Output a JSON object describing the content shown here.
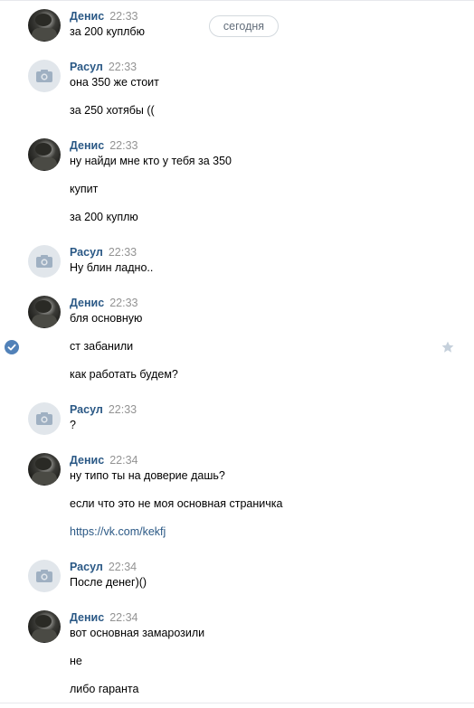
{
  "date_separator": "сегодня",
  "messages": [
    {
      "author": "Денис",
      "time": "22:33",
      "avatar": "photo",
      "lines": [
        "за 200 куплбю"
      ]
    },
    {
      "author": "Расул",
      "time": "22:33",
      "avatar": "camera-icon",
      "lines": [
        "она 350 же стоит",
        "за 250 хотябы (("
      ]
    },
    {
      "author": "Денис",
      "time": "22:33",
      "avatar": "photo",
      "lines": [
        "ну найди мне кто у тебя за 350",
        "купит",
        "за 200 куплю"
      ]
    },
    {
      "author": "Расул",
      "time": "22:33",
      "avatar": "camera-icon",
      "lines": [
        "Ну блин ладно.."
      ]
    },
    {
      "author": "Денис",
      "time": "22:33",
      "avatar": "photo",
      "lines": [
        "бля основную",
        "ст забанили",
        "как работать будем?"
      ]
    },
    {
      "author": "Расул",
      "time": "22:33",
      "avatar": "camera-icon",
      "lines": [
        "?"
      ]
    },
    {
      "author": "Денис",
      "time": "22:34",
      "avatar": "photo",
      "lines": [
        "ну типо ты на доверие дашь?",
        "если что это не моя основная страничка",
        "https://vk.com/kekfj"
      ]
    },
    {
      "author": "Расул",
      "time": "22:34",
      "avatar": "camera-icon",
      "lines": [
        "После денег)()"
      ]
    },
    {
      "author": "Денис",
      "time": "22:34",
      "avatar": "photo",
      "lines": [
        "вот основная замарозили",
        "не",
        "либо гаранта"
      ]
    }
  ],
  "selected_message_icon": "check-circle-icon",
  "favorite_icon": "star-icon",
  "colors": {
    "author": "#2a5885",
    "time": "#939393",
    "link": "#2a5885",
    "check": "#5181b8",
    "star": "#c5d0db"
  }
}
